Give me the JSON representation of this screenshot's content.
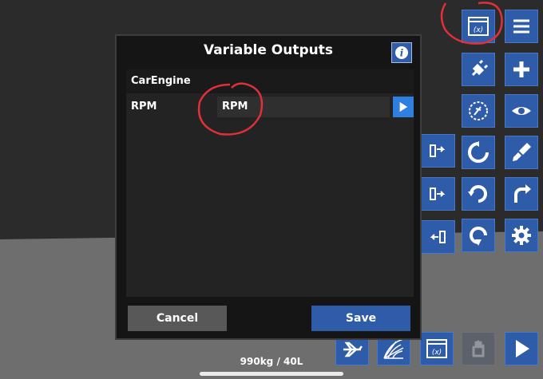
{
  "dialog": {
    "title": "Variable Outputs",
    "section": "CarEngine",
    "rows": [
      {
        "label": "RPM",
        "value": "RPM"
      }
    ],
    "cancel_label": "Cancel",
    "save_label": "Save"
  },
  "status": {
    "mass_fuel": "990kg / 40L"
  },
  "colors": {
    "accent": "#2f5ca8",
    "annotation": "#e0303a"
  },
  "toolbar_icons": [
    "variables-icon",
    "menu-icon",
    "connect-icon",
    "add-icon",
    "gyro-icon",
    "view-icon",
    "rotate-icon",
    "paint-icon",
    "reset-rotation-icon",
    "redo-icon",
    "undo-rotation-icon",
    "settings-icon"
  ],
  "bottom_icons": [
    "aircraft-icon",
    "grid-icon",
    "variables-icon",
    "hand-icon",
    "play-icon"
  ]
}
